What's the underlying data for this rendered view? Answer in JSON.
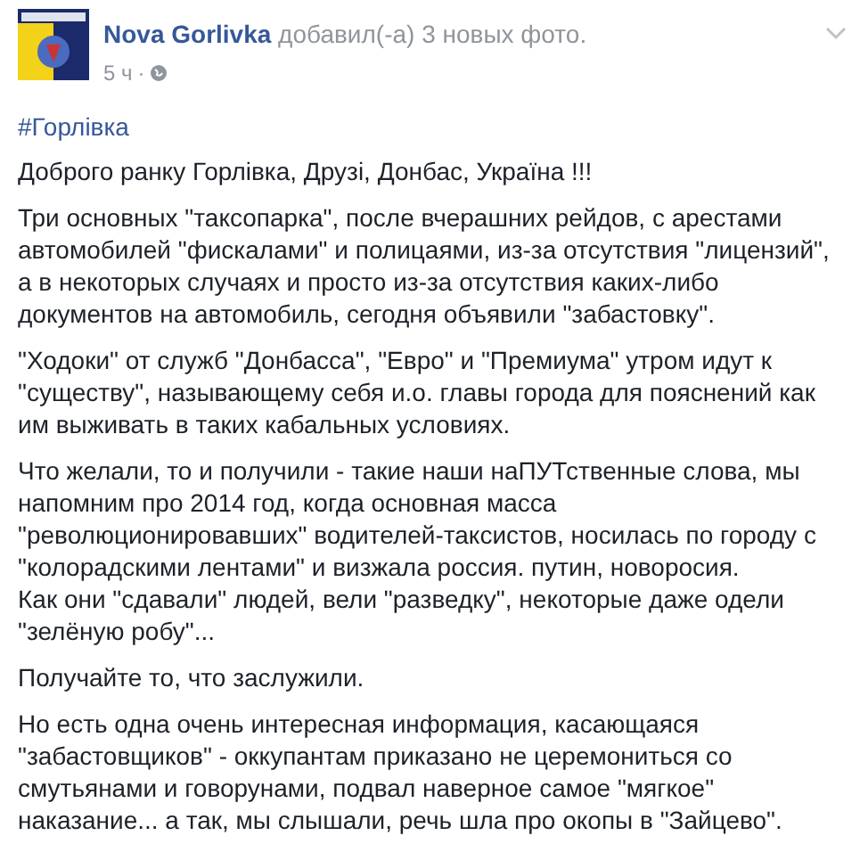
{
  "post": {
    "author": "Nova Gorlivka",
    "action": "добавил(-а) 3 новых фото.",
    "time": "5 ч",
    "separator": "·",
    "hashtag": "#Горлівка",
    "paragraphs": [
      "Доброго ранку Горлівка, Друзі, Донбас, Україна !!!",
      "Три основных \"таксопарка\", после вчерашних рейдов, с арестами автомобилей \"фискалами\" и полицаями, из-за отсутствия \"лицензий\", а в некоторых случаях и просто из-за отсутствия каких-либо документов на автомобиль, сегодня объявили \"забастовку\".",
      "\"Ходоки\" от служб \"Донбасса\", \"Евро\" и \"Премиума\" утром идут к \"существу\", называющему себя и.о. главы города для пояснений как им выживать в таких кабальных условиях.",
      "Что желали, то и получили - такие наши наПУТственные слова, мы напомним про 2014 год, когда основная масса \"революционировавших\" водителей-таксистов, носилась по городу с \"колорадскими лентами\" и визжала россия. путин, новоросия.\nКак они \"сдавали\" людей, вели \"разведку\", некоторые даже одели \"зелёную робу\"...",
      "Получайте то, что заслужили.",
      "Но есть одна очень интересная информация, касающаяся \"забастовщиков\" - оккупантам приказано не церемониться со смутьянами и говорунами, подвал наверное самое \"мягкое\" наказание... а так, мы слышали, речь шла про окопы в \"Зайцево\"."
    ]
  }
}
